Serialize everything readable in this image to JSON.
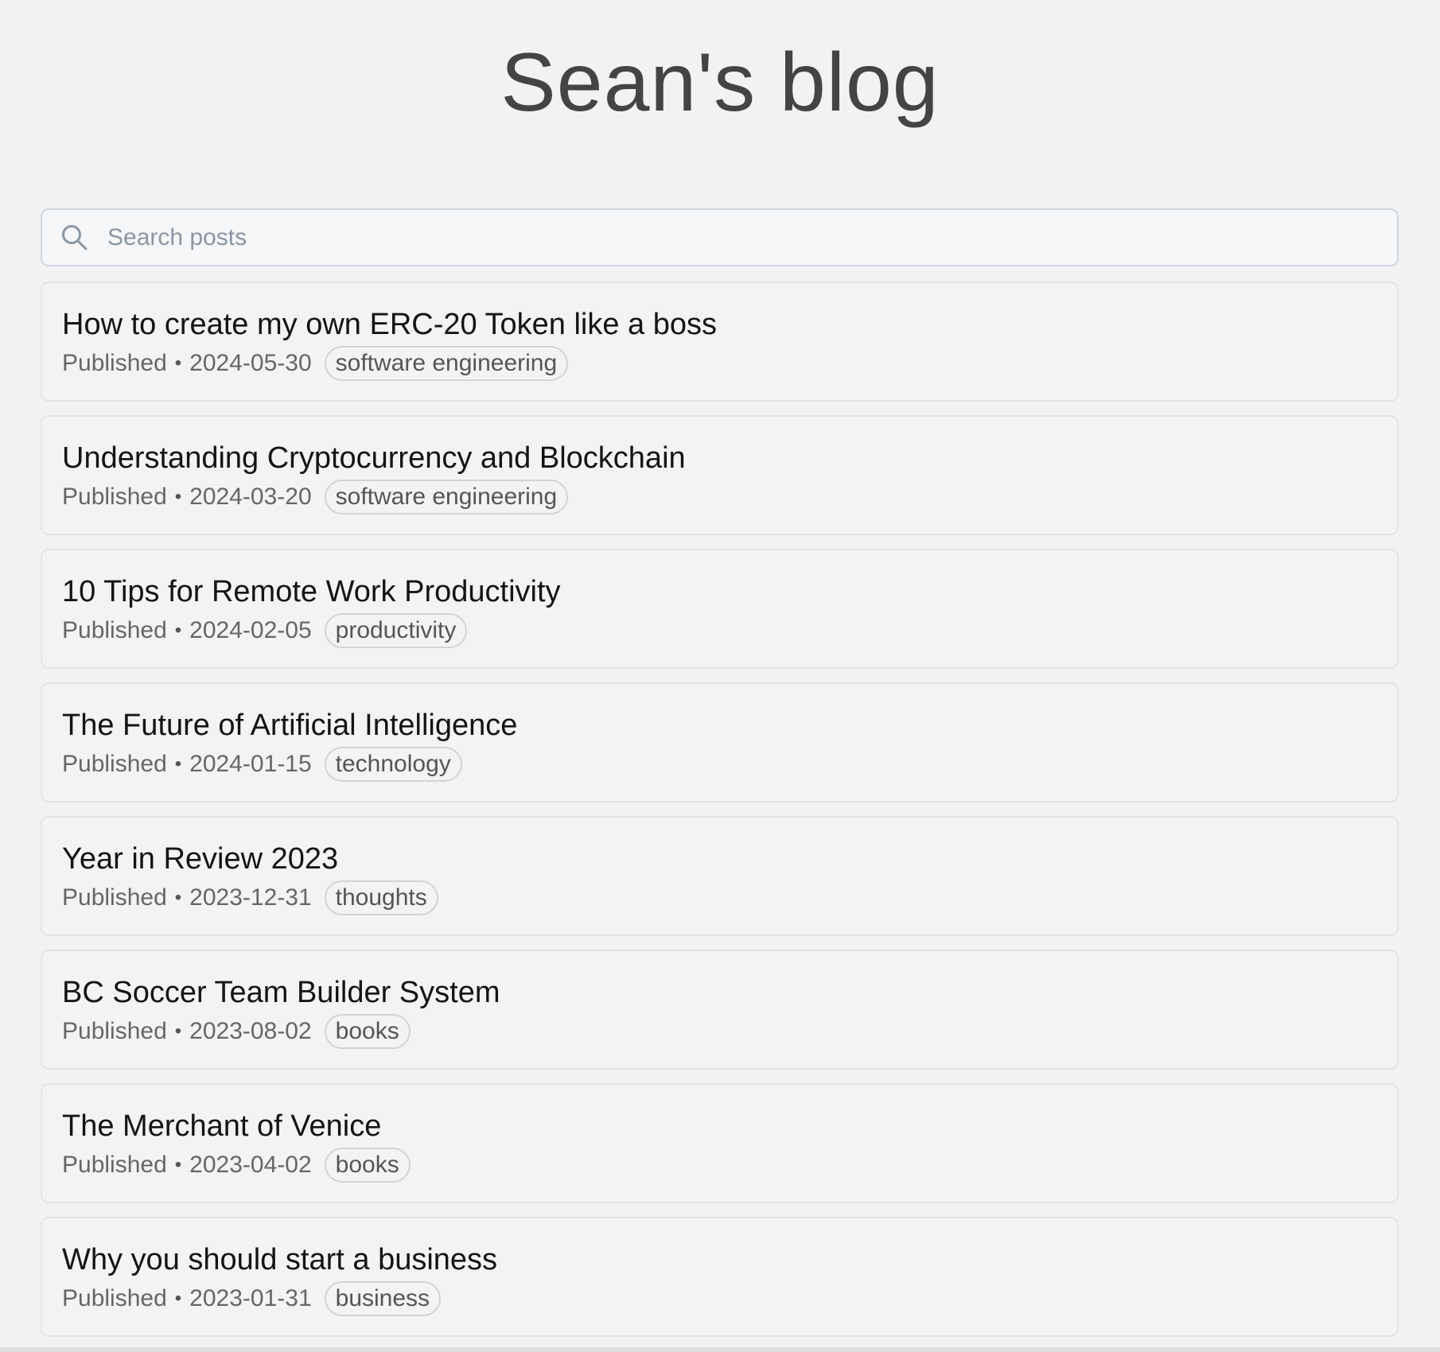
{
  "header": {
    "title": "Sean's blog"
  },
  "search": {
    "placeholder": "Search posts",
    "icon": "search-icon"
  },
  "posts": [
    {
      "title": "How to create my own ERC-20 Token like a boss",
      "status": "Published",
      "separator": "•",
      "date": "2024-05-30",
      "tag": "software engineering"
    },
    {
      "title": "Understanding Cryptocurrency and Blockchain",
      "status": "Published",
      "separator": "•",
      "date": "2024-03-20",
      "tag": "software engineering"
    },
    {
      "title": "10 Tips for Remote Work Productivity",
      "status": "Published",
      "separator": "•",
      "date": "2024-02-05",
      "tag": "productivity"
    },
    {
      "title": "The Future of Artificial Intelligence",
      "status": "Published",
      "separator": "•",
      "date": "2024-01-15",
      "tag": "technology"
    },
    {
      "title": "Year in Review 2023",
      "status": "Published",
      "separator": "•",
      "date": "2023-12-31",
      "tag": "thoughts"
    },
    {
      "title": "BC Soccer Team Builder System",
      "status": "Published",
      "separator": "•",
      "date": "2023-08-02",
      "tag": "books"
    },
    {
      "title": "The Merchant of Venice",
      "status": "Published",
      "separator": "•",
      "date": "2023-04-02",
      "tag": "books"
    },
    {
      "title": "Why you should start a business",
      "status": "Published",
      "separator": "•",
      "date": "2023-01-31",
      "tag": "business"
    }
  ],
  "colors": {
    "background": "#f2f2f2",
    "title": "#444444",
    "card_border": "#e3e3e3",
    "search_border": "#cfd6de"
  }
}
